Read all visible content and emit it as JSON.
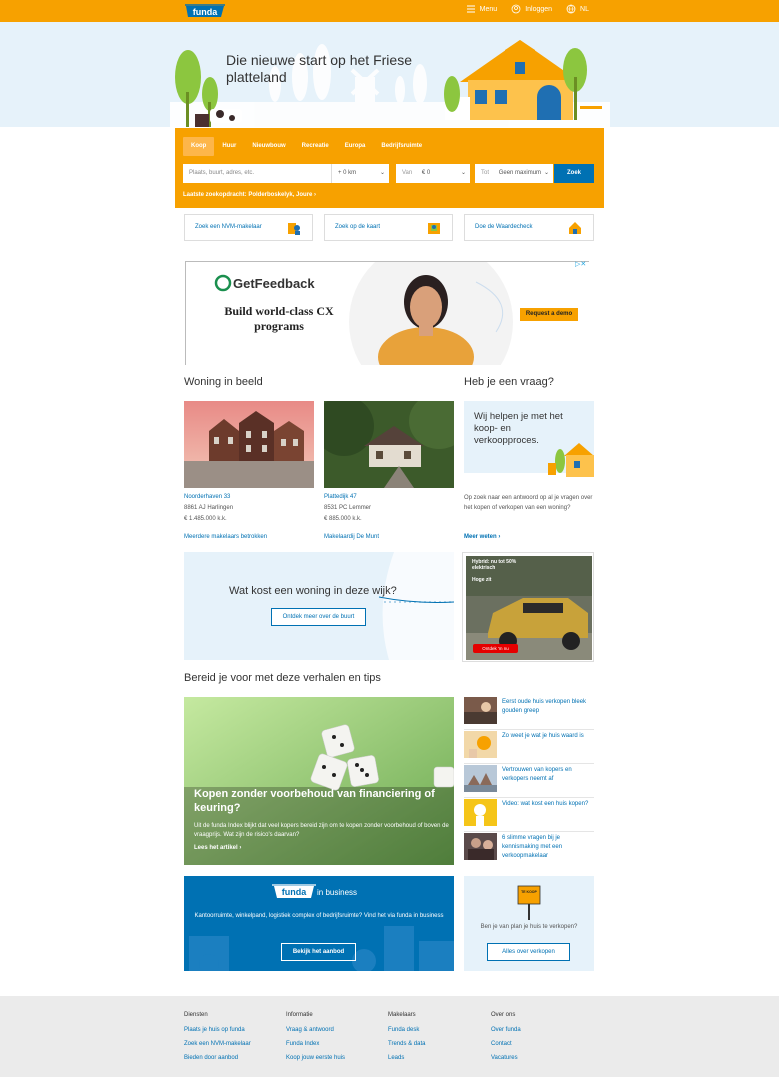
{
  "topbar": {
    "logo_text": "funda",
    "menu_label": "Menu",
    "login_label": "Inloggen",
    "lang_label": "NL"
  },
  "hero": {
    "title": "Die nieuwe start op het Friese platteland"
  },
  "search": {
    "tabs": [
      "Koop",
      "Huur",
      "Nieuwbouw",
      "Recreatie",
      "Europa",
      "Bedrijfsruimte"
    ],
    "active_tab": "Koop",
    "location_placeholder": "Plaats, buurt, adres, etc.",
    "radius_value": "+ 0 km",
    "from_label": "Van",
    "from_value": "€ 0",
    "to_label": "Tot",
    "to_value": "Geen maximum",
    "submit_label": "Zoek",
    "last_search": "Laatste zoekopdracht: Polderboskelyk, Joure"
  },
  "quicklinks": [
    {
      "label": "Zoek een NVM-makelaar"
    },
    {
      "label": "Zoek op de kaart"
    },
    {
      "label": "Doe de Waardecheck"
    }
  ],
  "ad1": {
    "brand": "GetFeedback",
    "headline_line1": "Build world-class CX",
    "headline_line2": "programs",
    "cta": "Request a demo"
  },
  "woning": {
    "heading": "Woning in beeld",
    "items": [
      {
        "address": "Noorderhaven 33",
        "city": "8861 AJ Harlingen",
        "price": "€ 1.485.000 k.k.",
        "agent": "Meerdere makelaars betrokken"
      },
      {
        "address": "Plattedijk 47",
        "city": "8531 PC Lemmer",
        "price": "€ 885.000 k.k.",
        "agent": "Makelaardij De Munt"
      }
    ]
  },
  "vraag": {
    "heading": "Heb je een vraag?",
    "image_text": "Wij helpen je met het koop- en verkoopproces.",
    "body": "Op zoek naar een antwoord op al je vragen over het kopen of verkopen van een woning?",
    "link": "Meer weten"
  },
  "buurt": {
    "title": "Wat kost een woning in deze wijk?",
    "button": "Ontdek meer over de buurt"
  },
  "ad2": {
    "headline": "Hybrid: nu tot 50% elektrisch",
    "sub": "Hoge zit",
    "cta": "Ontdek 'm nu"
  },
  "tips": {
    "heading": "Bereid je voor met deze verhalen en tips",
    "main_title": "Kopen zonder voorbehoud van financiering of keuring?",
    "main_desc": "Uit de funda Index blijkt dat veel kopers bereid zijn om te kopen zonder voorbehoud of boven de vraagprijs. Wat zijn de risico's daarvan?",
    "main_link": "Lees het artikel",
    "items": [
      {
        "title": "Eerst oude huis verkopen bleek gouden greep"
      },
      {
        "title": "Zo weet je wat je huis waard is"
      },
      {
        "title": "Vertrouwen van kopers en verkopers neemt af"
      },
      {
        "title": "Video: wat kost een huis kopen?"
      },
      {
        "title": "6 slimme vragen bij je kennismaking met een verkoopmakelaar"
      }
    ]
  },
  "business": {
    "logo_text": "funda",
    "suffix": "in business",
    "desc": "Kantoorruimte, winkelpand, logistiek complex of bedrijfsruimte? Vind het via funda in business",
    "button": "Bekijk het aanbod"
  },
  "sell": {
    "sign_text": "TE KOOP",
    "question": "Ben je van plan je huis te verkopen?",
    "button": "Alles over verkopen"
  },
  "footer": {
    "cols": [
      {
        "heading": "Diensten",
        "links": [
          "Plaats je huis op funda",
          "Zoek een NVM-makelaar",
          "Bieden door aanbod"
        ]
      },
      {
        "heading": "Informatie",
        "links": [
          "Vraag & antwoord",
          "Funda Index",
          "Koop jouw eerste huis"
        ]
      },
      {
        "heading": "Makelaars",
        "links": [
          "Funda desk",
          "Trends & data",
          "Leads"
        ]
      },
      {
        "heading": "Over ons",
        "links": [
          "Over funda",
          "Contact",
          "Vacatures"
        ]
      }
    ]
  },
  "colors": {
    "brand_orange": "#f7a100",
    "brand_blue": "#0071b3",
    "hero_bg": "#e6f2fa"
  }
}
